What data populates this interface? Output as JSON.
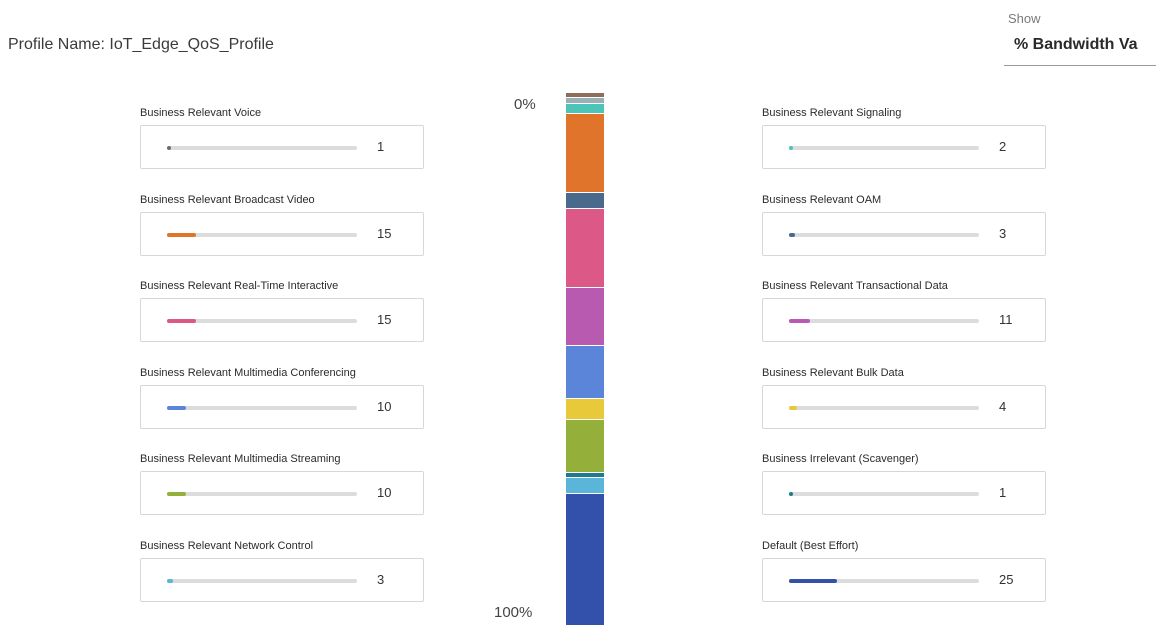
{
  "profile": {
    "name_text": "Profile Name: IoT_Edge_QoS_Profile"
  },
  "show": {
    "label": "Show",
    "selected": "% Bandwidth Va"
  },
  "distribution_bar": {
    "top_label": "0%",
    "bottom_label": "100%"
  },
  "left_items": [
    {
      "label": "Business Relevant Voice",
      "value": "1",
      "percent": 1,
      "color": "#6e6e6e",
      "icon": "none"
    },
    {
      "label": "Business Relevant Broadcast Video",
      "value": "15",
      "percent": 15,
      "color": "#e0742a"
    },
    {
      "label": "Business Relevant Real-Time Interactive",
      "value": "15",
      "percent": 15,
      "color": "#db5887"
    },
    {
      "label": "Business Relevant Multimedia Conferencing",
      "value": "10",
      "percent": 10,
      "color": "#5b85d9"
    },
    {
      "label": "Business Relevant Multimedia Streaming",
      "value": "10",
      "percent": 10,
      "color": "#95b03a"
    },
    {
      "label": "Business Relevant Network Control",
      "value": "3",
      "percent": 3,
      "color": "#5bb5d9"
    }
  ],
  "right_items": [
    {
      "label": "Business Relevant Signaling",
      "value": "2",
      "percent": 2,
      "color": "#4cc4b8"
    },
    {
      "label": "Business Relevant OAM",
      "value": "3",
      "percent": 3,
      "color": "#4a6a8c"
    },
    {
      "label": "Business Relevant Transactional Data",
      "value": "11",
      "percent": 11,
      "color": "#b85ab0"
    },
    {
      "label": "Business Relevant Bulk Data",
      "value": "4",
      "percent": 4,
      "color": "#e8c93a"
    },
    {
      "label": "Business Irrelevant (Scavenger)",
      "value": "1",
      "percent": 1,
      "color": "#1f7a8c"
    },
    {
      "label": "Default (Best Effort)",
      "value": "25",
      "percent": 25,
      "color": "#3350aa"
    }
  ],
  "stack_segments": [
    {
      "name": "Business Relevant Voice",
      "percent": 1,
      "color": "#8c6e5a"
    },
    {
      "name": "Business Relevant Network Control",
      "percent": 1,
      "color": "#9ab0b8"
    },
    {
      "name": "Business Relevant Signaling",
      "percent": 2,
      "color": "#4cc4b8"
    },
    {
      "name": "Business Relevant Broadcast Video",
      "percent": 15,
      "color": "#e0742a"
    },
    {
      "name": "Business Relevant OAM",
      "percent": 3,
      "color": "#4a6a8c"
    },
    {
      "name": "Business Relevant Real-Time Interactive",
      "percent": 15,
      "color": "#db5887"
    },
    {
      "name": "Business Relevant Transactional Data",
      "percent": 11,
      "color": "#b85ab0"
    },
    {
      "name": "Business Relevant Multimedia Conferencing",
      "percent": 10,
      "color": "#5b85d9"
    },
    {
      "name": "Business Relevant Bulk Data",
      "percent": 4,
      "color": "#e8c93a"
    },
    {
      "name": "Business Relevant Multimedia Streaming",
      "percent": 10,
      "color": "#95b03a"
    },
    {
      "name": "Business Irrelevant (Scavenger)",
      "percent": 1,
      "color": "#1f7a8c"
    },
    {
      "name": "Business Relevant Network Control",
      "percent": 3,
      "color": "#5bb5d9"
    },
    {
      "name": "Default (Best Effort)",
      "percent": 25,
      "color": "#3350aa"
    }
  ]
}
